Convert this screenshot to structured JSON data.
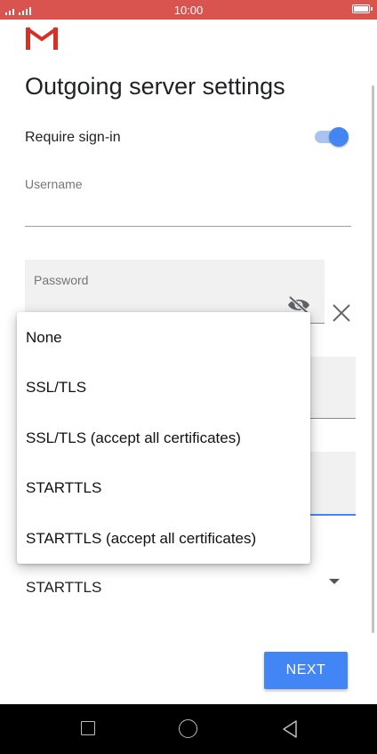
{
  "status_bar": {
    "time": "10:00"
  },
  "page": {
    "title": "Outgoing server settings"
  },
  "require_signin": {
    "label": "Require sign-in",
    "enabled": true
  },
  "username": {
    "label": "Username",
    "value": ""
  },
  "password": {
    "label": "Password",
    "value": ""
  },
  "security": {
    "selected": "STARTTLS"
  },
  "dropdown": {
    "options": [
      "None",
      "SSL/TLS",
      "SSL/TLS (accept all certificates)",
      "STARTTLS",
      "STARTTLS (accept all certificates)"
    ]
  },
  "next_button": {
    "label": "NEXT"
  },
  "colors": {
    "accent": "#4285f4",
    "status_bar": "#d9534f",
    "nav_bar": "#000000"
  },
  "icons": [
    "gmail-logo-icon",
    "signal-icon",
    "battery-icon",
    "visibility-off-icon",
    "close-icon",
    "dropdown-arrow-icon",
    "nav-recents-icon",
    "nav-home-icon",
    "nav-back-icon"
  ]
}
